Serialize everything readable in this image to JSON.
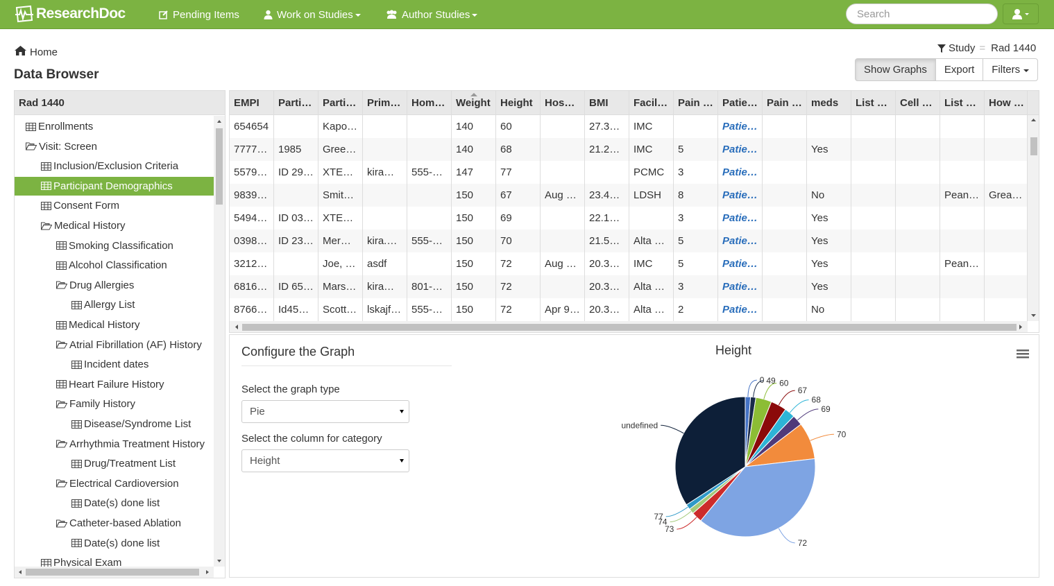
{
  "nav": {
    "brand": "ResearchDoc",
    "pending": "Pending Items",
    "work": "Work on Studies",
    "author": "Author Studies",
    "search_placeholder": "Search"
  },
  "breadcrumb": {
    "home": "Home"
  },
  "page_title": "Data Browser",
  "study_filter": {
    "label": "Study",
    "sep": "=",
    "value": "Rad 1440"
  },
  "toolbar": {
    "show_graphs": "Show Graphs",
    "export": "Export",
    "filters": "Filters"
  },
  "tree": {
    "title": "Rad 1440",
    "items": [
      {
        "label": "Enrollments",
        "icon": "table-icon"
      },
      {
        "label": "Visit: Screen",
        "icon": "folder-open-icon"
      },
      {
        "label": "Inclusion/Exclusion Criteria",
        "icon": "table-icon"
      },
      {
        "label": "Participant Demographics",
        "icon": "table-icon"
      },
      {
        "label": "Consent Form",
        "icon": "table-icon"
      },
      {
        "label": "Medical History",
        "icon": "folder-open-icon"
      },
      {
        "label": "Smoking Classification",
        "icon": "table-icon"
      },
      {
        "label": "Alcohol Classification",
        "icon": "table-icon"
      },
      {
        "label": "Drug Allergies",
        "icon": "folder-open-icon"
      },
      {
        "label": "Allergy List",
        "icon": "table-icon"
      },
      {
        "label": "Medical History",
        "icon": "table-icon"
      },
      {
        "label": "Atrial Fibrillation (AF) History",
        "icon": "folder-open-icon"
      },
      {
        "label": "Incident dates",
        "icon": "table-icon"
      },
      {
        "label": "Heart Failure History",
        "icon": "table-icon"
      },
      {
        "label": "Family History",
        "icon": "folder-open-icon"
      },
      {
        "label": "Disease/Syndrome List",
        "icon": "table-icon"
      },
      {
        "label": "Arrhythmia Treatment History",
        "icon": "folder-open-icon"
      },
      {
        "label": "Drug/Treatment List",
        "icon": "table-icon"
      },
      {
        "label": "Electrical Cardioversion",
        "icon": "folder-open-icon"
      },
      {
        "label": "Date(s) done list",
        "icon": "table-icon"
      },
      {
        "label": "Catheter-based Ablation",
        "icon": "folder-open-icon"
      },
      {
        "label": "Date(s) done list",
        "icon": "table-icon"
      },
      {
        "label": "Physical Exam",
        "icon": "table-icon"
      }
    ]
  },
  "grid": {
    "columns": [
      "EMPI",
      "Parti…",
      "Parti…",
      "Prim…",
      "Hom…",
      "Weight",
      "Height",
      "Hos…",
      "BMI",
      "Facil…",
      "Pain …",
      "Patie…",
      "Pain …",
      "meds",
      "List …",
      "Cell …",
      "List …",
      "How …"
    ],
    "rows": [
      [
        "654654",
        "",
        "Kapo…",
        "",
        "",
        "140",
        "60",
        "",
        "27.3…",
        "IMC",
        "",
        "Patie…",
        "",
        "",
        "",
        "",
        "",
        ""
      ],
      [
        "7777…",
        "1985",
        "Gree…",
        "",
        "",
        "140",
        "68",
        "",
        "21.2…",
        "IMC",
        "5",
        "Patie…",
        "",
        "Yes",
        "",
        "",
        "",
        ""
      ],
      [
        "5579…",
        "ID 29…",
        "XTE…",
        "kira…",
        "555-…",
        "147",
        "77",
        "",
        "",
        "PCMC",
        "3",
        "Patie…",
        "",
        "",
        "",
        "",
        "",
        ""
      ],
      [
        "9839…",
        "",
        "Smit…",
        "",
        "",
        "150",
        "67",
        "Aug …",
        "23.4…",
        "LDSH",
        "8",
        "Patie…",
        "",
        "No",
        "",
        "",
        "Pean…",
        "Grea…"
      ],
      [
        "5494…",
        "ID 03…",
        "XTE…",
        "",
        "",
        "150",
        "69",
        "",
        "22.1…",
        "",
        "3",
        "Patie…",
        "",
        "Yes",
        "",
        "",
        "",
        ""
      ],
      [
        "0398…",
        "ID 23…",
        "Mer…",
        "kira.…",
        "555-…",
        "150",
        "70",
        "",
        "21.5…",
        "Alta …",
        "5",
        "Patie…",
        "",
        "Yes",
        "",
        "",
        "",
        ""
      ],
      [
        "3212…",
        "",
        "Joe, …",
        "asdf",
        "",
        "150",
        "72",
        "Aug …",
        "20.3…",
        "IMC",
        "5",
        "Patie…",
        "",
        "Yes",
        "",
        "",
        "Pean…",
        ""
      ],
      [
        "6816…",
        "ID 65…",
        "Mars…",
        "kira…",
        "801-…",
        "150",
        "72",
        "",
        "20.3…",
        "Alta …",
        "3",
        "Patie…",
        "",
        "Yes",
        "",
        "",
        "",
        ""
      ],
      [
        "8766…",
        "Id45…",
        "Scott…",
        "lskajf…",
        "555-…",
        "150",
        "72",
        "Apr 9…",
        "20.3…",
        "Alta …",
        "2",
        "Patie…",
        "",
        "No",
        "",
        "",
        "",
        ""
      ]
    ]
  },
  "config": {
    "title": "Configure the Graph",
    "type_label": "Select the graph type",
    "type_value": "Pie",
    "column_label": "Select the column for category",
    "column_value": "Height"
  },
  "chart_data": {
    "type": "pie",
    "title": "Height",
    "categories": [
      "0",
      "49",
      "60",
      "67",
      "68",
      "69",
      "70",
      "72",
      "73",
      "74",
      "77",
      "undefined"
    ],
    "values": [
      1,
      1,
      3,
      3,
      2,
      2,
      7,
      31,
      2,
      1,
      1,
      28
    ],
    "colors": [
      "#4472c4",
      "#1a2b4a",
      "#8cbd35",
      "#8b0a0a",
      "#2db4d6",
      "#4f3a7a",
      "#f28b3c",
      "#7ea4e3",
      "#cc2b2b",
      "#a3c97a",
      "#2e99c8",
      "#0d1f38"
    ]
  },
  "colors": {
    "navbar": "#7cb342",
    "selected": "#7cb342",
    "link": "#2a6ebb"
  }
}
